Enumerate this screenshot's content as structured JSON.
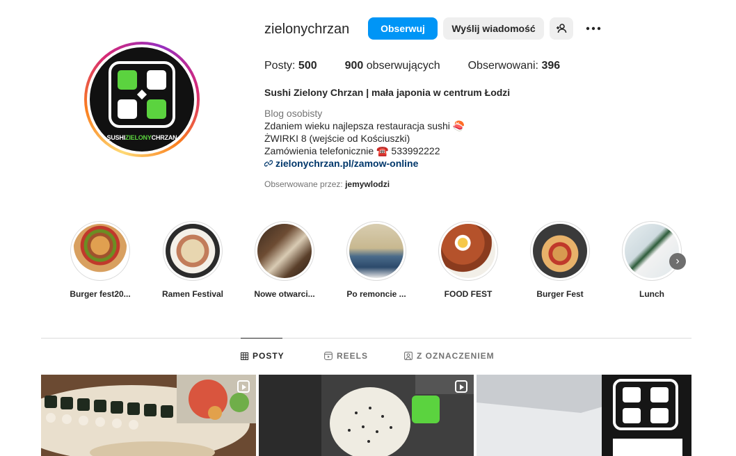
{
  "profile": {
    "username": "zielonychrzan",
    "logo_text_left": "SUSHI",
    "logo_text_mid": "ZIELONY",
    "logo_text_right": "CHRZAN",
    "buttons": {
      "follow": "Obserwuj",
      "message": "Wyślij wiadomość",
      "add_user_icon": "person-plus-icon",
      "more_icon": "more-horizontal-icon"
    },
    "stats": {
      "posts_label": "Posty:",
      "posts_value": "500",
      "followers_value": "900",
      "followers_label": "obserwujących",
      "following_label": "Obserwowani:",
      "following_value": "396"
    },
    "full_name": "Sushi Zielony Chrzan | mała japonia w centrum Łodzi",
    "category": "Blog osobisty",
    "bio": [
      "Zdaniem wieku najlepsza restauracja sushi 🍣",
      "ŻWIRKI 8 (wejście od Kościuszki)",
      "Zamówienia telefonicznie ☎️ 533992222"
    ],
    "link": "zielonychrzan.pl/zamow-online",
    "followed_by_label": "Obserwowane przez:",
    "followed_by_user": "jemywlodzi"
  },
  "highlights": [
    {
      "label": "Burger fest20..."
    },
    {
      "label": "Ramen Festival"
    },
    {
      "label": "Nowe otwarci..."
    },
    {
      "label": "Po remoncie ..."
    },
    {
      "label": "FOOD FEST"
    },
    {
      "label": "Burger Fest"
    },
    {
      "label": "Lunch"
    }
  ],
  "tabs": [
    {
      "label": "POSTY",
      "icon": "grid-icon",
      "active": true
    },
    {
      "label": "REELS",
      "icon": "reels-icon",
      "active": false
    },
    {
      "label": "Z OZNACZENIEM",
      "icon": "tagged-icon",
      "active": false
    }
  ],
  "colors": {
    "follow_button": "#0095f6",
    "brand_green": "#5bd33f",
    "link": "#00376b"
  }
}
